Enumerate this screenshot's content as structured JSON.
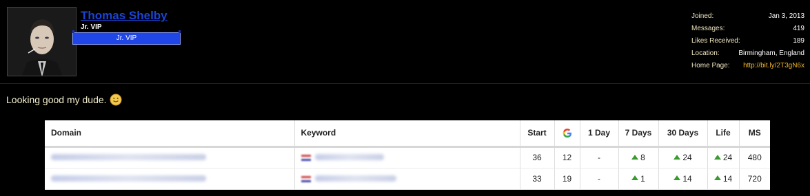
{
  "user": {
    "name": "Thomas Shelby",
    "title": "Jr. VIP",
    "banner": "Jr. VIP"
  },
  "stats": [
    {
      "label": "Joined:",
      "value": "Jan 3, 2013"
    },
    {
      "label": "Messages:",
      "value": "419"
    },
    {
      "label": "Likes Received:",
      "value": "189"
    },
    {
      "label": "Location:",
      "value": "Birmingham, England"
    },
    {
      "label": "Home Page:",
      "value": "http://bit.ly/2T3gN6x"
    }
  ],
  "message": "Looking good my dude.",
  "table": {
    "headers": [
      "Domain",
      "Keyword",
      "Start",
      "",
      "1 Day",
      "7 Days",
      "30 Days",
      "Life",
      "MS"
    ],
    "rows": [
      {
        "start": "36",
        "google": "12",
        "day1": "-",
        "days7": "8",
        "days30": "24",
        "life": "24",
        "ms": "480"
      },
      {
        "start": "33",
        "google": "19",
        "day1": "-",
        "days7": "1",
        "days30": "14",
        "life": "14",
        "ms": "720"
      }
    ]
  },
  "colors": {
    "username": "#1b44d6",
    "banner": "#2146e8",
    "link": "#f0b429",
    "arrow_up": "#3a9a2f"
  },
  "icons": [
    "google-icon",
    "arrow-up-icon",
    "smiley-icon"
  ]
}
